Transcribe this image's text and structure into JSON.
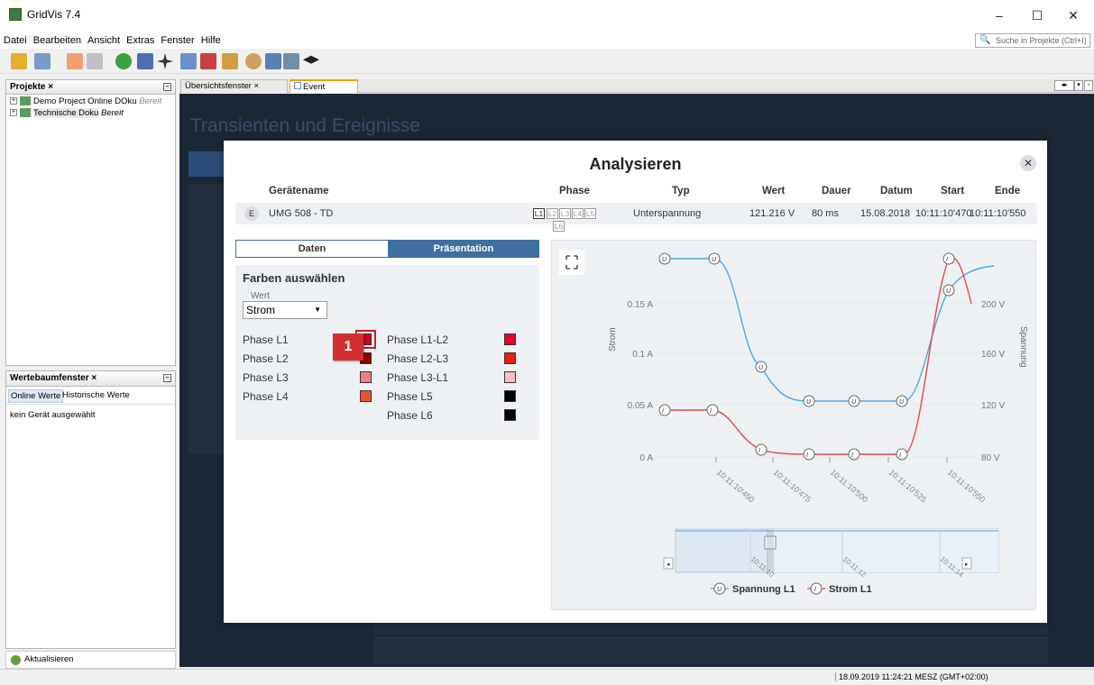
{
  "window": {
    "title": "GridVis 7.4",
    "min": "–",
    "max": "☐",
    "close": "✕"
  },
  "menu": [
    "Datei",
    "Bearbeiten",
    "Ansicht",
    "Extras",
    "Fenster",
    "Hilfe"
  ],
  "search_placeholder": "Suche in Projekte (Ctrl+I)",
  "projects_panel": {
    "title": "Projekte ×",
    "items": [
      {
        "name": "Demo Project Online DOku",
        "status": "Bereit"
      },
      {
        "name": "Technische Doku",
        "status": "Bereit"
      }
    ]
  },
  "werte_panel": {
    "title": "Wertebaumfenster ×",
    "tab_online": "Online Werte",
    "tab_hist": "Historische Werte",
    "empty": "kein Gerät ausgewählt"
  },
  "aktualisieren": "Aktualisieren",
  "editor_tabs": [
    {
      "label": "Übersichtsfenster ×"
    },
    {
      "label": "Event Browser ×"
    }
  ],
  "background_title": "Transienten und Ereignisse",
  "status_time": "18.09.2019 11:24:21 MESZ (GMT+02:00)",
  "modal": {
    "title": "Analysieren",
    "close": "✕",
    "headers": {
      "device": "Gerätename",
      "phase": "Phase",
      "type": "Typ",
      "value": "Wert",
      "duration": "Dauer",
      "date": "Datum",
      "start": "Start",
      "end": "Ende"
    },
    "event": {
      "icon": "E",
      "device": "UMG 508 - TD",
      "phases": [
        "L1",
        "L2",
        "L3",
        "L4",
        "L5",
        "L6"
      ],
      "active_phase": "L1",
      "type": "Unterspannung",
      "value": "121.216 V",
      "duration": "80 ms",
      "date": "15.08.2018",
      "start": "10:11:10'470",
      "end": "10:11:10'550"
    },
    "tabs": {
      "data": "Daten",
      "presentation": "Präsentation"
    },
    "colors_title": "Farben auswählen",
    "wert_label": "Wert",
    "wert_value": "Strom",
    "phases_left": [
      {
        "label": "Phase L1",
        "color": "#d0021b"
      },
      {
        "label": "Phase L2",
        "color": "#8b0000"
      },
      {
        "label": "Phase L3",
        "color": "#f08080"
      },
      {
        "label": "Phase L4",
        "color": "#f05030"
      }
    ],
    "phases_right": [
      {
        "label": "Phase L1-L2",
        "color": "#e8002a"
      },
      {
        "label": "Phase L2-L3",
        "color": "#f01818"
      },
      {
        "label": "Phase L3-L1",
        "color": "#f7c0c0"
      },
      {
        "label": "Phase L5",
        "color": "#000000"
      },
      {
        "label": "Phase L6",
        "color": "#000000"
      }
    ],
    "badge": "1"
  },
  "chart_data": {
    "type": "line",
    "x": [
      "10:11:10'450",
      "10:11:10'475",
      "10:11:10'500",
      "10:11:10'525",
      "10:11:10'550"
    ],
    "ylabel_left": "Strom",
    "ylabel_right": "Spannung",
    "left_ticks": [
      "0 A",
      "0.05 A",
      "0.1 A",
      "0.15 A"
    ],
    "right_ticks": [
      "80 V",
      "120 V",
      "160 V",
      "200 V"
    ],
    "navigator_ticks": [
      "10:11:10",
      "10:11:12",
      "10:11:14"
    ],
    "series": [
      {
        "name": "Spannung L1",
        "color": "#4aa8e8",
        "marker": "U"
      },
      {
        "name": "Strom L1",
        "color": "#e84848",
        "marker": "I"
      }
    ]
  }
}
